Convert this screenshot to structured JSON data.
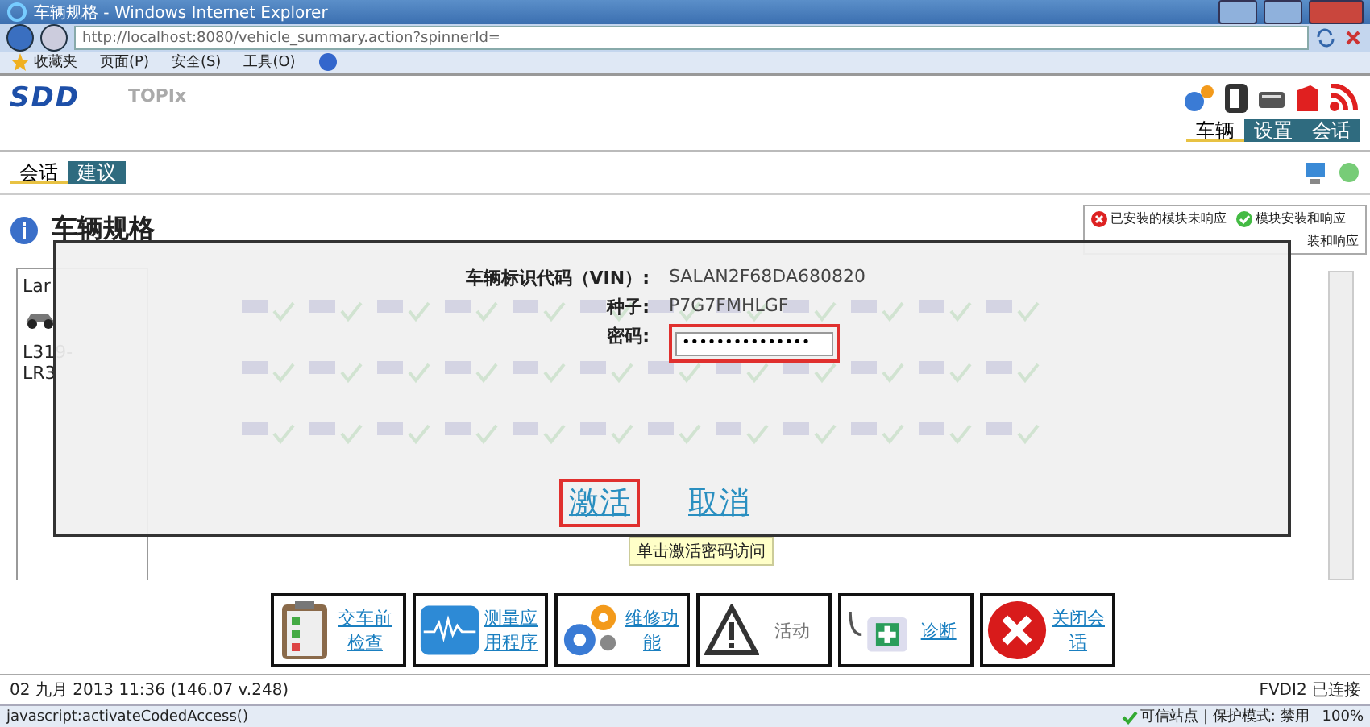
{
  "window": {
    "title": "车辆规格 - Windows Internet Explorer"
  },
  "address_bar": {
    "url": "http://localhost:8080/vehicle_summary.action?spinnerId="
  },
  "toolbar": {
    "favorites": "收藏夹",
    "menus": [
      "页面(P)",
      "安全(S)",
      "工具(O)"
    ]
  },
  "app_header": {
    "logo": "SDD",
    "product": "TOPIx",
    "tabs": [
      {
        "label": "车辆",
        "selected": true
      },
      {
        "label": "设置",
        "selected": false
      },
      {
        "label": "会话",
        "selected": false
      }
    ]
  },
  "sub_tabs": [
    {
      "label": "会话",
      "selected": true
    },
    {
      "label": "建议",
      "selected": false
    }
  ],
  "page_title": "车辆规格",
  "legend": [
    {
      "kind": "error",
      "label": "已安装的模块未响应"
    },
    {
      "kind": "ok",
      "label": "模块安装和响应"
    }
  ],
  "legend_fragment": "装和响应",
  "sidebar": {
    "texts": [
      "Lar",
      "L319-",
      "LR3"
    ]
  },
  "dialog": {
    "fields": [
      {
        "kind": "text",
        "label": "车辆标识代码（VIN）:",
        "value": "SALAN2F68DA680820"
      },
      {
        "kind": "text",
        "label": "种子:",
        "value": "P7G7FMHLGF"
      },
      {
        "kind": "input",
        "label": "密码:",
        "value": "•••••••••••••••",
        "highlighted": true
      }
    ],
    "buttons": [
      {
        "label": "激活",
        "highlighted": true
      },
      {
        "label": "取消",
        "highlighted": false
      }
    ],
    "tooltip": "单击激活密码访问"
  },
  "actions": [
    {
      "label": "交车前检查",
      "kind": "clipboard",
      "disabled": false
    },
    {
      "label": "测量应用程序",
      "kind": "wave",
      "disabled": false
    },
    {
      "label": "维修功能",
      "kind": "gears",
      "disabled": false
    },
    {
      "label": "活动",
      "kind": "warning",
      "disabled": true
    },
    {
      "label": "诊断",
      "kind": "medkit",
      "disabled": false
    },
    {
      "label": "关闭会话",
      "kind": "close",
      "disabled": false
    }
  ],
  "footer": {
    "timestamp": "02 九月 2013 11:36 (146.07 v.248)",
    "connection": "FVDI2 已连接"
  },
  "status_bar": {
    "text": "javascript:activateCodedAccess()",
    "zone": "可信站点 | 保护模式: 禁用",
    "zoom": "100%"
  }
}
